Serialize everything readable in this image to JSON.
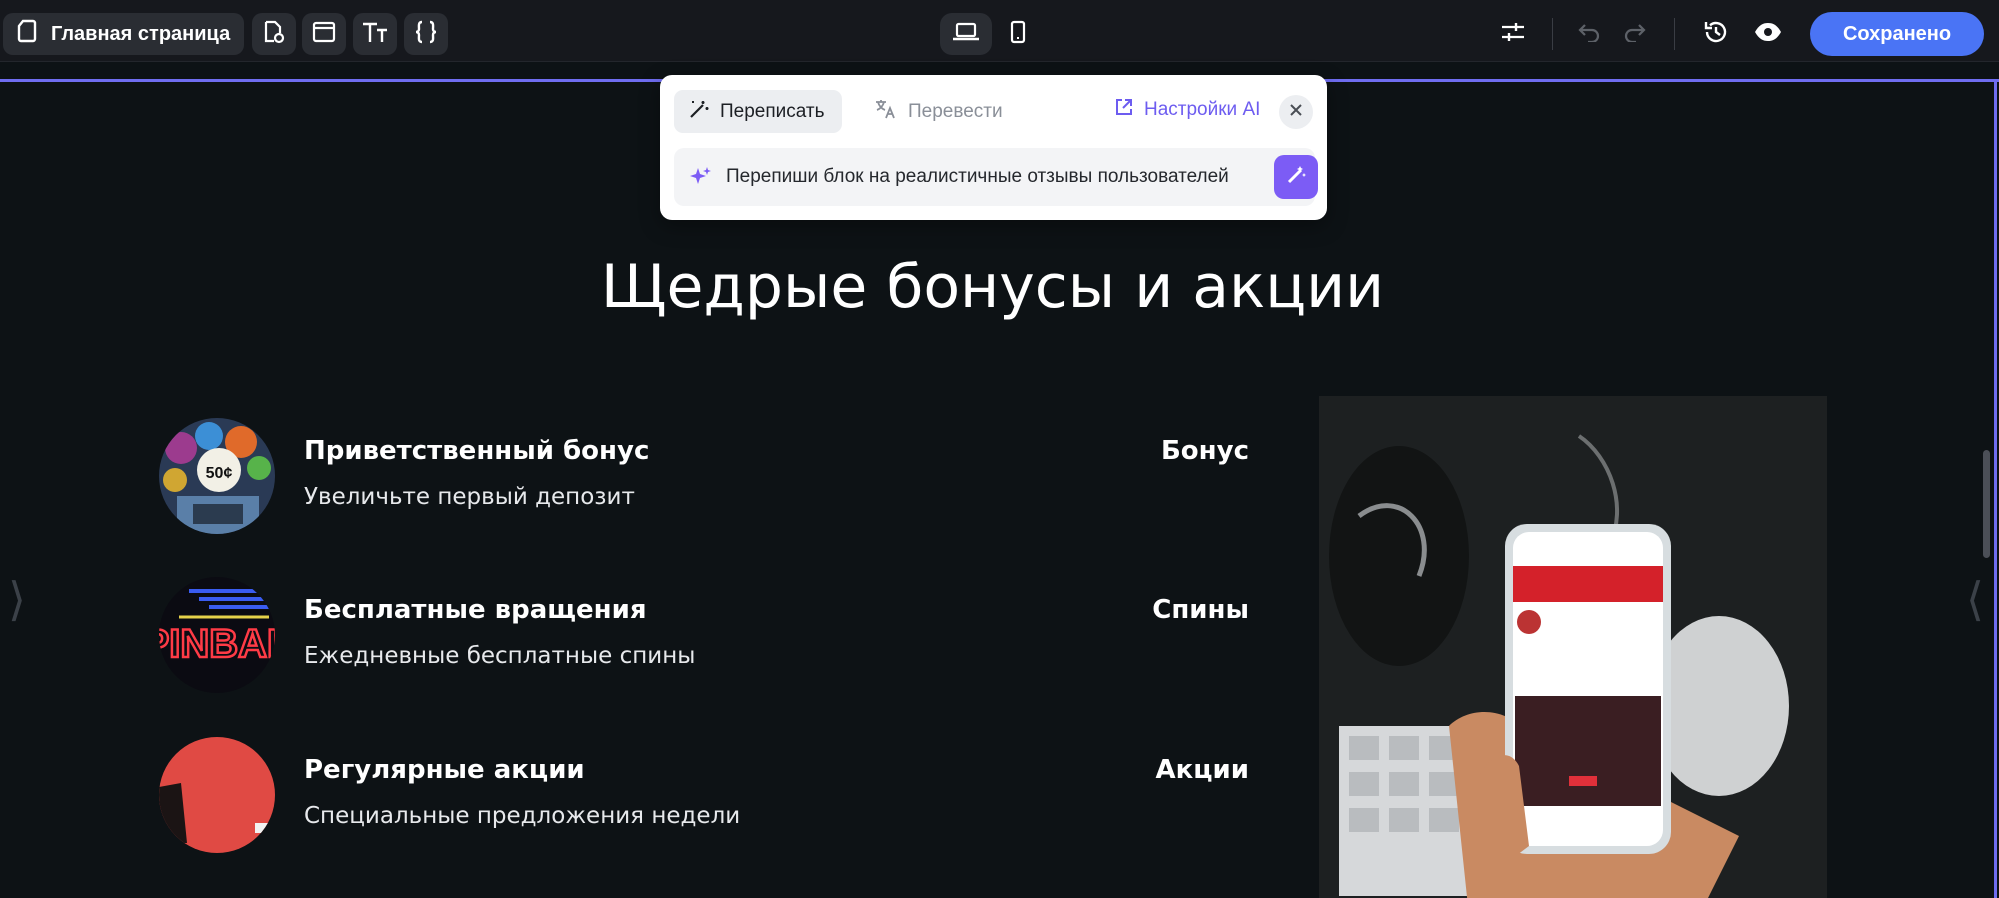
{
  "topbar": {
    "page_button_label": "Главная страница",
    "save_label": "Сохранено",
    "colors": {
      "accent": "#4a74f5",
      "bar": "#16181d"
    }
  },
  "ai_panel": {
    "tab_rewrite": "Переписать",
    "tab_translate": "Перевести",
    "settings_label": "Настройки AI",
    "prompt_value": "Перепиши блок на реалистичные отзывы пользователей",
    "accent": "#7c5cf5"
  },
  "section": {
    "heading": "Щедрые бонусы и акции",
    "items": [
      {
        "title": "Приветственный бонус",
        "desc": "Увеличьте первый депозит",
        "tag": "Бонус"
      },
      {
        "title": "Бесплатные вращения",
        "desc": "Ежедневные бесплатные спины",
        "tag": "Спины"
      },
      {
        "title": "Регулярные акции",
        "desc": "Специальные предложения недели",
        "tag": "Акции"
      }
    ]
  }
}
